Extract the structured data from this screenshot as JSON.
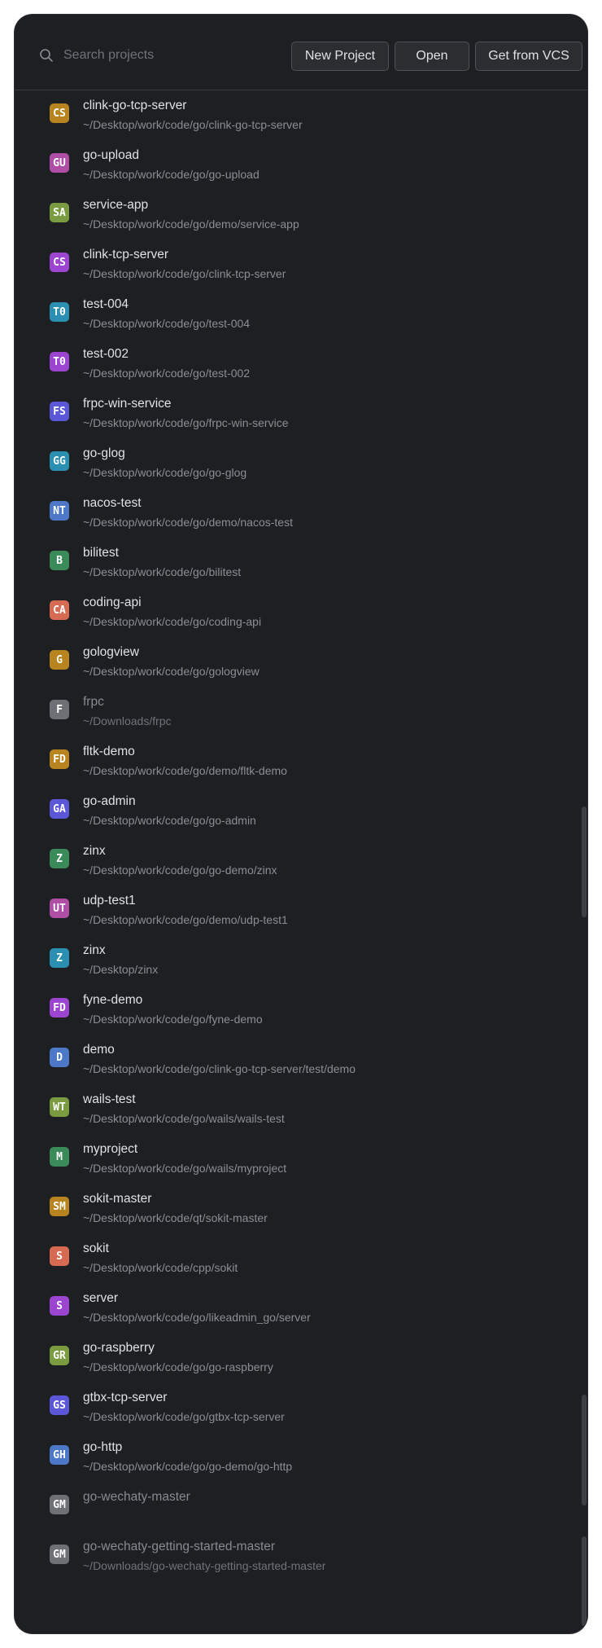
{
  "search": {
    "placeholder": "Search projects",
    "value": ""
  },
  "buttons": {
    "new_project": "New Project",
    "open": "Open",
    "get_from_vcs": "Get from VCS"
  },
  "projects": [
    {
      "initials": "CS",
      "name": "clink-go-tcp-server",
      "path": "~/Desktop/work/code/go/clink-go-tcp-server",
      "color": "#b8841f"
    },
    {
      "initials": "GU",
      "name": "go-upload",
      "path": "~/Desktop/work/code/go/go-upload",
      "color": "#b04ea6"
    },
    {
      "initials": "SA",
      "name": "service-app",
      "path": "~/Desktop/work/code/go/demo/service-app",
      "color": "#7a9b3f"
    },
    {
      "initials": "CS",
      "name": "clink-tcp-server",
      "path": "~/Desktop/work/code/go/clink-tcp-server",
      "color": "#9b45d1"
    },
    {
      "initials": "T0",
      "name": "test-004",
      "path": "~/Desktop/work/code/go/test-004",
      "color": "#2a8fb0"
    },
    {
      "initials": "T0",
      "name": "test-002",
      "path": "~/Desktop/work/code/go/test-002",
      "color": "#9b45d1"
    },
    {
      "initials": "FS",
      "name": "frpc-win-service",
      "path": "~/Desktop/work/code/go/frpc-win-service",
      "color": "#5b57d8"
    },
    {
      "initials": "GG",
      "name": "go-glog",
      "path": "~/Desktop/work/code/go/go-glog",
      "color": "#2a8fb0"
    },
    {
      "initials": "NT",
      "name": "nacos-test",
      "path": "~/Desktop/work/code/go/demo/nacos-test",
      "color": "#4d78c8"
    },
    {
      "initials": "B",
      "name": "bilitest",
      "path": "~/Desktop/work/code/go/bilitest",
      "color": "#3b8a5a"
    },
    {
      "initials": "CA",
      "name": "coding-api",
      "path": "~/Desktop/work/code/go/coding-api",
      "color": "#d66a52"
    },
    {
      "initials": "G",
      "name": "gologview",
      "path": "~/Desktop/work/code/go/gologview",
      "color": "#b8841f"
    },
    {
      "initials": "F",
      "name": "frpc",
      "path": "~/Downloads/frpc",
      "color": "#6e7075",
      "dim": true
    },
    {
      "initials": "FD",
      "name": "fltk-demo",
      "path": "~/Desktop/work/code/go/demo/fltk-demo",
      "color": "#b8841f"
    },
    {
      "initials": "GA",
      "name": "go-admin",
      "path": "~/Desktop/work/code/go/go-admin",
      "color": "#5b57d8"
    },
    {
      "initials": "Z",
      "name": "zinx",
      "path": "~/Desktop/work/code/go/go-demo/zinx",
      "color": "#3b8a5a"
    },
    {
      "initials": "UT",
      "name": "udp-test1",
      "path": "~/Desktop/work/code/go/demo/udp-test1",
      "color": "#b04ea6"
    },
    {
      "initials": "Z",
      "name": "zinx",
      "path": "~/Desktop/zinx",
      "color": "#2a8fb0"
    },
    {
      "initials": "FD",
      "name": "fyne-demo",
      "path": "~/Desktop/work/code/go/fyne-demo",
      "color": "#9b45d1"
    },
    {
      "initials": "D",
      "name": "demo",
      "path": "~/Desktop/work/code/go/clink-go-tcp-server/test/demo",
      "color": "#4d78c8"
    },
    {
      "initials": "WT",
      "name": "wails-test",
      "path": "~/Desktop/work/code/go/wails/wails-test",
      "color": "#7a9b3f"
    },
    {
      "initials": "M",
      "name": "myproject",
      "path": "~/Desktop/work/code/go/wails/myproject",
      "color": "#3b8a5a"
    },
    {
      "initials": "SM",
      "name": "sokit-master",
      "path": "~/Desktop/work/code/qt/sokit-master",
      "color": "#b8841f"
    },
    {
      "initials": "S",
      "name": "sokit",
      "path": "~/Desktop/work/code/cpp/sokit",
      "color": "#d66a52"
    },
    {
      "initials": "S",
      "name": "server",
      "path": "~/Desktop/work/code/go/likeadmin_go/server",
      "color": "#9b45d1"
    },
    {
      "initials": "GR",
      "name": "go-raspberry",
      "path": "~/Desktop/work/code/go/go-raspberry",
      "color": "#7a9b3f"
    },
    {
      "initials": "GS",
      "name": "gtbx-tcp-server",
      "path": "~/Desktop/work/code/go/gtbx-tcp-server",
      "color": "#5b57d8"
    },
    {
      "initials": "GH",
      "name": "go-http",
      "path": "~/Desktop/work/code/go/go-demo/go-http",
      "color": "#4d78c8"
    },
    {
      "initials": "GM",
      "name": "go-wechaty-master",
      "path": "",
      "color": "#6e7075",
      "dim": true
    },
    {
      "initials": "GM",
      "name": "go-wechaty-getting-started-master",
      "path": "~/Downloads/go-wechaty-getting-started-master",
      "color": "#6e7075",
      "dim": true
    }
  ]
}
